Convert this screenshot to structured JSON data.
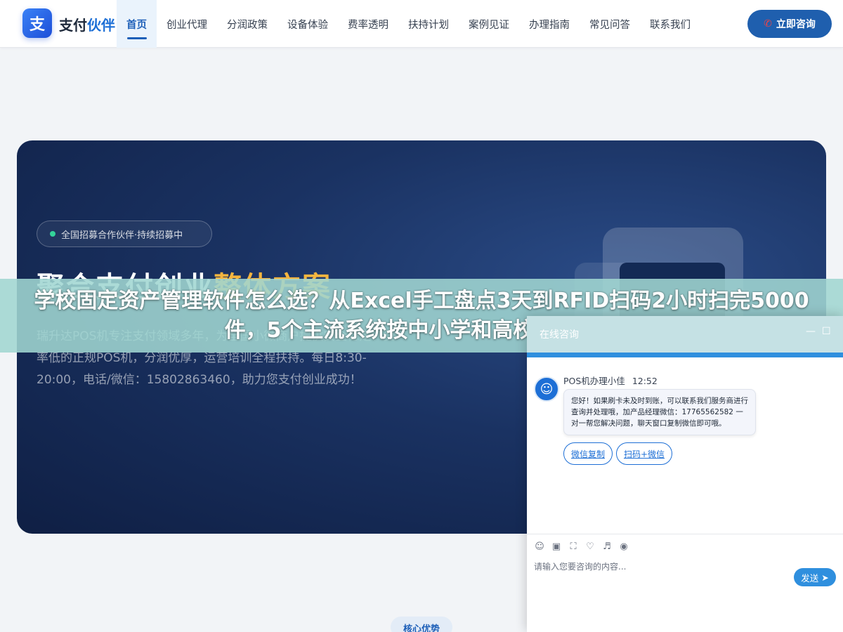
{
  "header": {
    "logo_char": "支",
    "brand_part1": "支付",
    "brand_part2": "伙伴",
    "nav": [
      "首页",
      "创业代理",
      "分润政策",
      "设备体验",
      "费率透明",
      "扶持计划",
      "案例见证",
      "办理指南",
      "常见问答",
      "联系我们"
    ],
    "active_index": 0,
    "cta_label": "立即咨询"
  },
  "hero": {
    "badge": "全国招募合作伙伴·持续招募中",
    "title_white": "聚合支付创业",
    "title_gold": "整体方案",
    "description": "瑞升达POS机专注支付领域多年，为全国小微商户提供安全稳定、费率低的正规POS机，分润优厚，运营培训全程扶持。每日8:30-20:00，电话/微信：15802863460，助力您支付创业成功！"
  },
  "article": {
    "title": "学校固定资产管理软件怎么选？从Excel手工盘点3天到RFID扫码2小时扫完5000件，5个主流系统按中小学和高校对号入座"
  },
  "chat": {
    "title": "在线咨询",
    "minimize": "—",
    "maximize": "☐",
    "agent_name": "POS机办理小佳",
    "time": "12:52",
    "message": "您好！如果刷卡未及时到账，可以联系我们服务商进行查询并处理哦，加产品经理微信：17765562582 一对一帮您解决问题，聊天窗口复制微信即可哦。",
    "quick_replies": [
      "微信复制",
      "扫码+微信"
    ],
    "placeholder": "请输入您要咨询的内容...",
    "send_label": "发送"
  },
  "section": {
    "core_label": "核心优势"
  }
}
